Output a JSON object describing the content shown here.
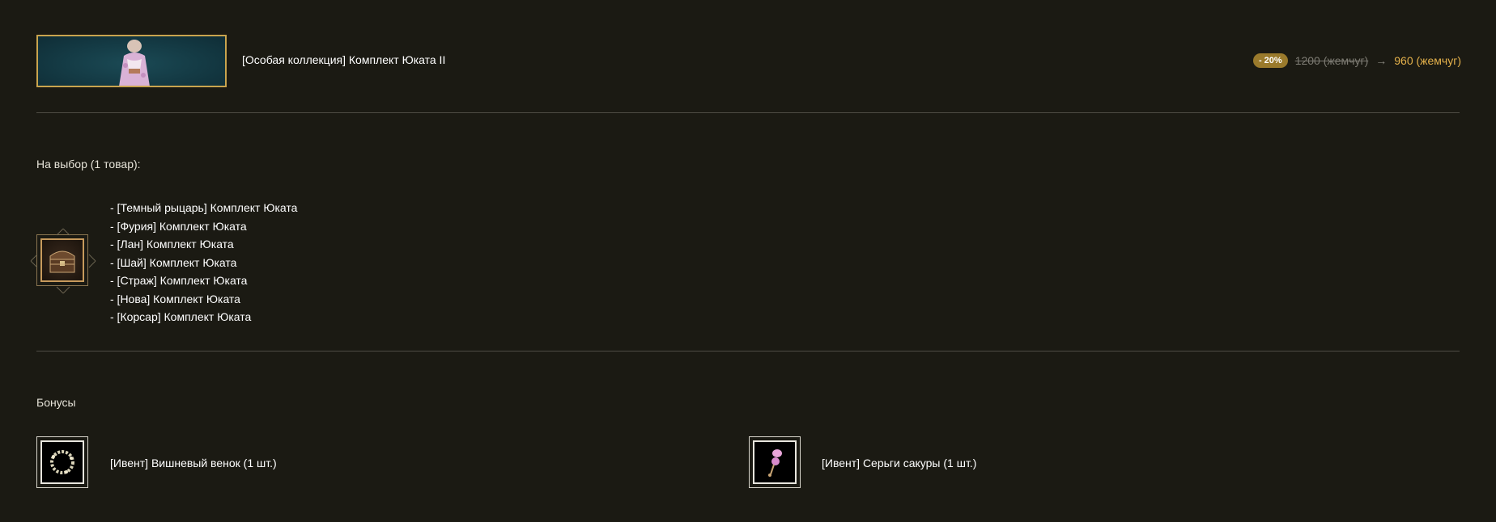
{
  "product": {
    "title": "[Особая коллекция] Комплект Юката II",
    "discount_badge": "- 20%",
    "old_price": "1200 (жемчуг)",
    "arrow": "→",
    "new_price": "960 (жемчуг)"
  },
  "choice": {
    "label": "На выбор (1 товар):",
    "items": [
      "- [Темный рыцарь] Комплект Юката",
      "- [Фурия] Комплект Юката",
      "- [Лан] Комплект Юката",
      "- [Шай] Комплект Юката",
      "- [Страж] Комплект Юката",
      "- [Нова] Комплект Юката",
      "- [Корсар] Комплект Юката"
    ]
  },
  "bonuses": {
    "label": "Бонусы",
    "items": [
      {
        "label": "[Ивент] Вишневый венок (1 шт.)",
        "icon": "cherry-wreath-icon"
      },
      {
        "label": "[Ивент] Серьги сакуры (1 шт.)",
        "icon": "sakura-earrings-icon"
      }
    ]
  },
  "colors": {
    "background": "#1b1a13",
    "accent_gold": "#e4b14b",
    "badge": "#9a7a2c",
    "banner_border": "#c9a44e"
  }
}
